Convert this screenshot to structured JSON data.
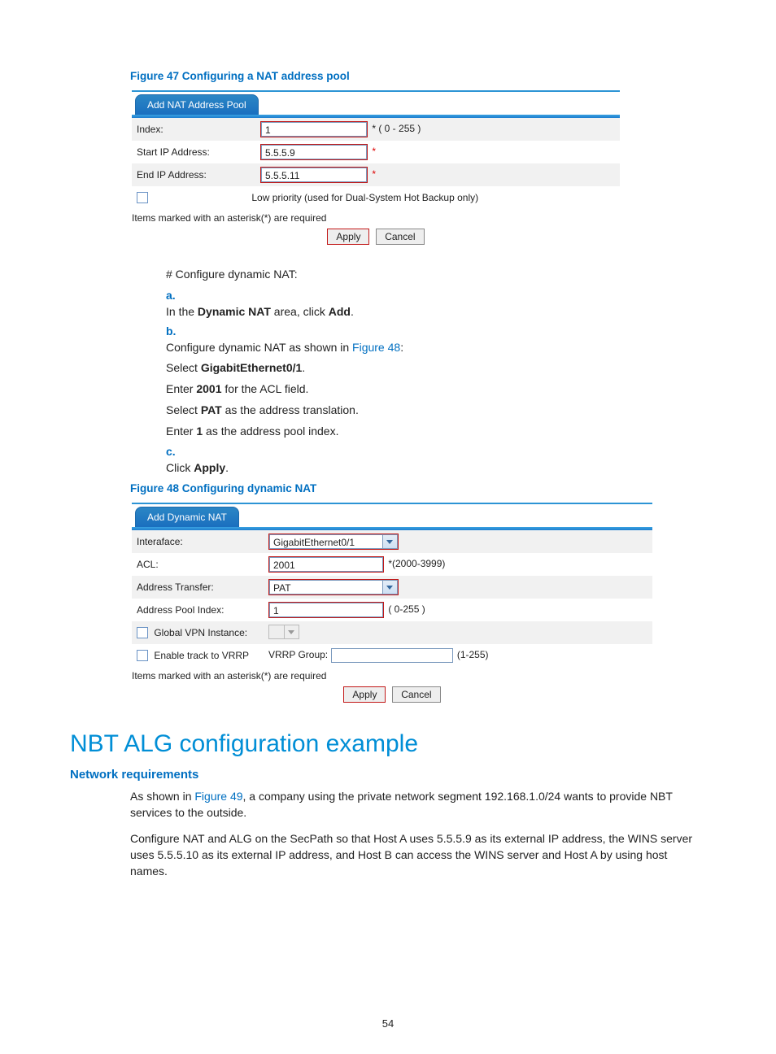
{
  "figure47": {
    "caption": "Figure 47 Configuring a NAT address pool",
    "tab": "Add NAT Address Pool",
    "rows": {
      "index_label": "Index:",
      "index_value": "1",
      "index_hint": "* ( 0 - 255 )",
      "start_ip_label": "Start IP Address:",
      "start_ip_value": "5.5.5.9",
      "end_ip_label": "End IP Address:",
      "end_ip_value": "5.5.5.11",
      "lowprio": "Low priority (used for Dual-System Hot Backup only)"
    },
    "footnote": "Items marked with an asterisk(*) are required",
    "apply": "Apply",
    "cancel": "Cancel"
  },
  "steps": {
    "intro": "# Configure dynamic NAT:",
    "a_label": "a.",
    "a_text_1": "In the ",
    "a_bold1": "Dynamic NAT",
    "a_text_2": " area, click ",
    "a_bold2": "Add",
    "a_text_3": ".",
    "b_label": "b.",
    "b_text_1": "Configure dynamic NAT as shown in ",
    "b_link": "Figure 48",
    "b_text_2": ":",
    "b_sub1_pre": "Select ",
    "b_sub1_bold": "GigabitEthernet0/1",
    "b_sub1_post": ".",
    "b_sub2_pre": "Enter ",
    "b_sub2_bold": "2001",
    "b_sub2_post": " for the ACL field.",
    "b_sub3_pre": "Select ",
    "b_sub3_bold": "PAT",
    "b_sub3_post": " as the address translation.",
    "b_sub4_pre": "Enter ",
    "b_sub4_bold": "1",
    "b_sub4_post": " as the address pool index.",
    "c_label": "c.",
    "c_text_pre": "Click ",
    "c_bold": "Apply",
    "c_text_post": "."
  },
  "figure48": {
    "caption": "Figure 48 Configuring dynamic NAT",
    "tab": "Add Dynamic NAT",
    "rows": {
      "iface_label": "Interaface:",
      "iface_value": "GigabitEthernet0/1",
      "acl_label": "ACL:",
      "acl_value": "2001",
      "acl_hint": "*(2000-3999)",
      "xfer_label": "Address Transfer:",
      "xfer_value": "PAT",
      "pool_label": "Address Pool Index:",
      "pool_value": "1",
      "pool_hint": "( 0-255 )",
      "gvpn_label": "Global VPN Instance:",
      "vrrp_cb_label": "Enable track to VRRP",
      "vrrp_group_label": "VRRP Group:",
      "vrrp_hint": "(1-255)"
    },
    "footnote": "Items marked with an asterisk(*) are required",
    "apply": "Apply",
    "cancel": "Cancel"
  },
  "section": {
    "heading": "NBT ALG configuration example",
    "sub": "Network requirements",
    "p1_pre": "As shown in ",
    "p1_link": "Figure 49",
    "p1_post": ", a company using the private network segment 192.168.1.0/24 wants to provide NBT services to the outside.",
    "p2": "Configure NAT and ALG on the SecPath so that Host A uses 5.5.5.9 as its external IP address, the WINS server uses 5.5.5.10 as its external IP address, and Host B can access the WINS server and Host A by using host names."
  },
  "page_number": "54"
}
